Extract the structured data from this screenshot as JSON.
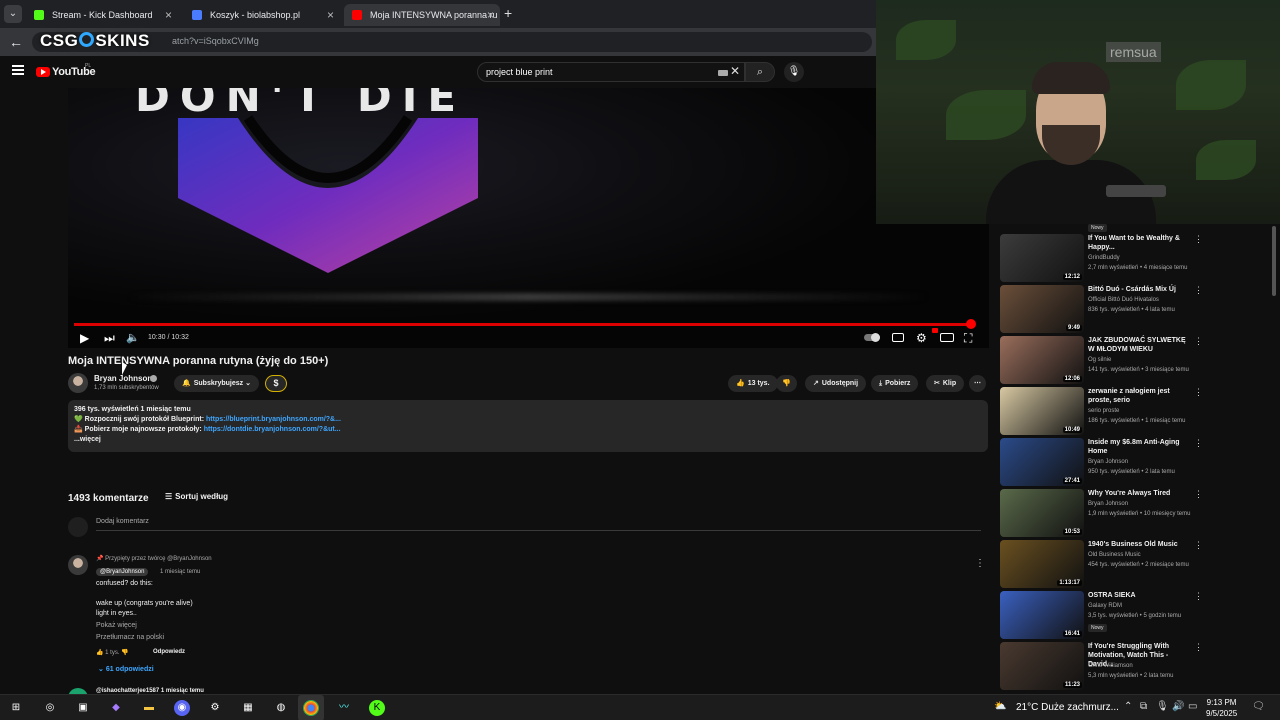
{
  "browser": {
    "tabs": [
      {
        "title": "Stream - Kick Dashboard",
        "favicon_color": "#53fc18"
      },
      {
        "title": "Koszyk - biolabshop.pl",
        "favicon_color": "#4a7cff"
      },
      {
        "title": "Moja INTENSYWNA poranna ru",
        "favicon_color": "#ff0000"
      }
    ],
    "url_visible": "atch?v=iSqobxCVIMg",
    "overlay_logo": "CSG SKINS"
  },
  "youtube": {
    "logo_text": "YouTube",
    "country_code": "PL",
    "search_query": "project blue print"
  },
  "video": {
    "thumbnail_text": "DON'T DIE",
    "time": "10:30 / 10:32",
    "progress_fraction": 0.99,
    "title": "Moja INTENSYWNA poranna rutyna (żyję do 150+)",
    "channel": "Bryan Johnson",
    "subscribers": "1,73 mln subskrybentów",
    "subscribed_label": "Subskrybujesz",
    "likes": "13 tys.",
    "share_label": "Udostępnij",
    "download_label": "Pobierz",
    "clip_label": "Klip"
  },
  "description": {
    "stats": "396 tys. wyświetleń  1 miesiąc temu",
    "line1_text": "💚 Rozpocznij swój protokół Blueprint: ",
    "line1_link": "https://blueprint.bryanjohnson.com/?&...",
    "line2_text": "📥 Pobierz moje najnowsze protokoły: ",
    "line2_link": "https://dontdie.bryanjohnson.com/?&ut...",
    "more": "...więcej"
  },
  "comments": {
    "count": "1493 komentarze",
    "sort_label": "Sortuj według",
    "add_placeholder": "Dodaj komentarz",
    "pinned": {
      "pinned_by": "Przypięty przez twórcę @BryanJohnson",
      "author": "@BryanJohnson",
      "time": "1 miesiąc temu",
      "lines": [
        "confused? do this:",
        "",
        "wake up (congrats you're alive)",
        "light in eyes.."
      ],
      "show_more": "Pokaż więcej",
      "translate": "Przetłumacz na polski",
      "likes": "1 tys.",
      "reply_label": "Odpowiedz",
      "replies": "61 odpowiedzi"
    },
    "next_author": "@ishaochatterjee1587 1 miesiąc temu"
  },
  "recommendations": [
    {
      "title": "If You Want to be Wealthy & Happy...",
      "channel": "GrindBuddy",
      "meta": "2,7 mln wyświetleń • 4 miesiące temu",
      "duration": "12:12",
      "thumb": "#3c3c3c",
      "badge": ""
    },
    {
      "title": "Bittó Duó - Csárdás Mix Új",
      "channel": "Official Bittó Duó Hivatalos",
      "meta": "836 tys. wyświetleń • 4 lata temu",
      "duration": "9:49",
      "thumb": "#6b4f3a",
      "badge": ""
    },
    {
      "title": "JAK ZBUDOWAĆ SYLWETKĘ W MŁODYM WIEKU",
      "channel": "Og silnie",
      "meta": "141 tys. wyświetleń • 3 miesiące temu",
      "duration": "12:06",
      "thumb": "#9a6e5c",
      "badge": ""
    },
    {
      "title": "zerwanie z nałogiem jest proste, serio",
      "channel": "serio proste",
      "meta": "186 tys. wyświetleń • 1 miesiąc temu",
      "duration": "10:49",
      "thumb": "#d8c9a3",
      "badge": ""
    },
    {
      "title": "Inside my $6.8m Anti-Aging Home",
      "channel": "Bryan Johnson",
      "meta": "950 tys. wyświetleń • 2 lata temu",
      "duration": "27:41",
      "thumb": "#2b4b8a",
      "badge": ""
    },
    {
      "title": "Why You're Always Tired",
      "channel": "Bryan Johnson",
      "meta": "1,9 mln wyświetleń • 10 miesięcy temu",
      "duration": "10:53",
      "thumb": "#5a6a4a",
      "badge": ""
    },
    {
      "title": "1940's Business Old Music",
      "channel": "Old Business Music",
      "meta": "454 tys. wyświetleń • 2 miesiące temu",
      "duration": "1:13:17",
      "thumb": "#6a5020",
      "badge": ""
    },
    {
      "title": "OSTRA SIEKA",
      "channel": "Galaxy RDM",
      "meta": "3,5 tys. wyświetleń • 5 godzin temu",
      "duration": "16:41",
      "thumb": "#3a60c0",
      "badge": "Nowy"
    },
    {
      "title": "If You're Struggling With Motivation, Watch This - David...",
      "channel": "Chris Williamson",
      "meta": "5,3 mln wyświetleń • 2 lata temu",
      "duration": "11:23",
      "thumb": "#4a3a30",
      "badge": ""
    }
  ],
  "first_rec_badge": "Nowy",
  "webcam": {
    "sign_text": "remsua"
  },
  "taskbar": {
    "weather": "21°C  Duże zachmurz...",
    "time": "9:13 PM",
    "date": "9/5/2025"
  }
}
